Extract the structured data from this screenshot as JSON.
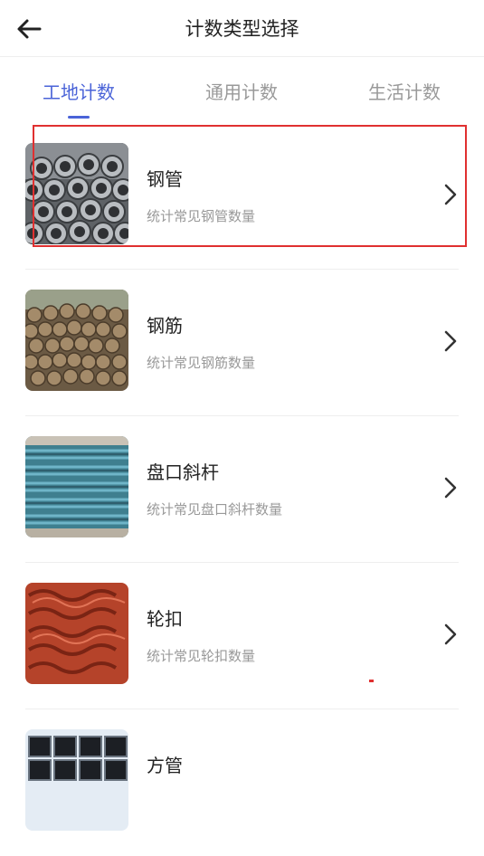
{
  "header": {
    "title": "计数类型选择",
    "back_icon": "arrow-left-icon"
  },
  "tabs": [
    {
      "label": "工地计数",
      "active": true
    },
    {
      "label": "通用计数",
      "active": false
    },
    {
      "label": "生活计数",
      "active": false
    }
  ],
  "colors": {
    "accent": "#4a63d8",
    "highlight": "#e03030"
  },
  "items": [
    {
      "name": "钢管",
      "desc": "统计常见钢管数量",
      "thumb": "steel-pipe-thumbnail"
    },
    {
      "name": "钢筋",
      "desc": "统计常见钢筋数量",
      "thumb": "rebar-thumbnail"
    },
    {
      "name": "盘口斜杆",
      "desc": "统计常见盘口斜杆数量",
      "thumb": "diagonal-rod-thumbnail"
    },
    {
      "name": "轮扣",
      "desc": "统计常见轮扣数量",
      "thumb": "wheel-buckle-thumbnail"
    },
    {
      "name": "方管",
      "desc": "",
      "thumb": "square-tube-thumbnail"
    }
  ]
}
